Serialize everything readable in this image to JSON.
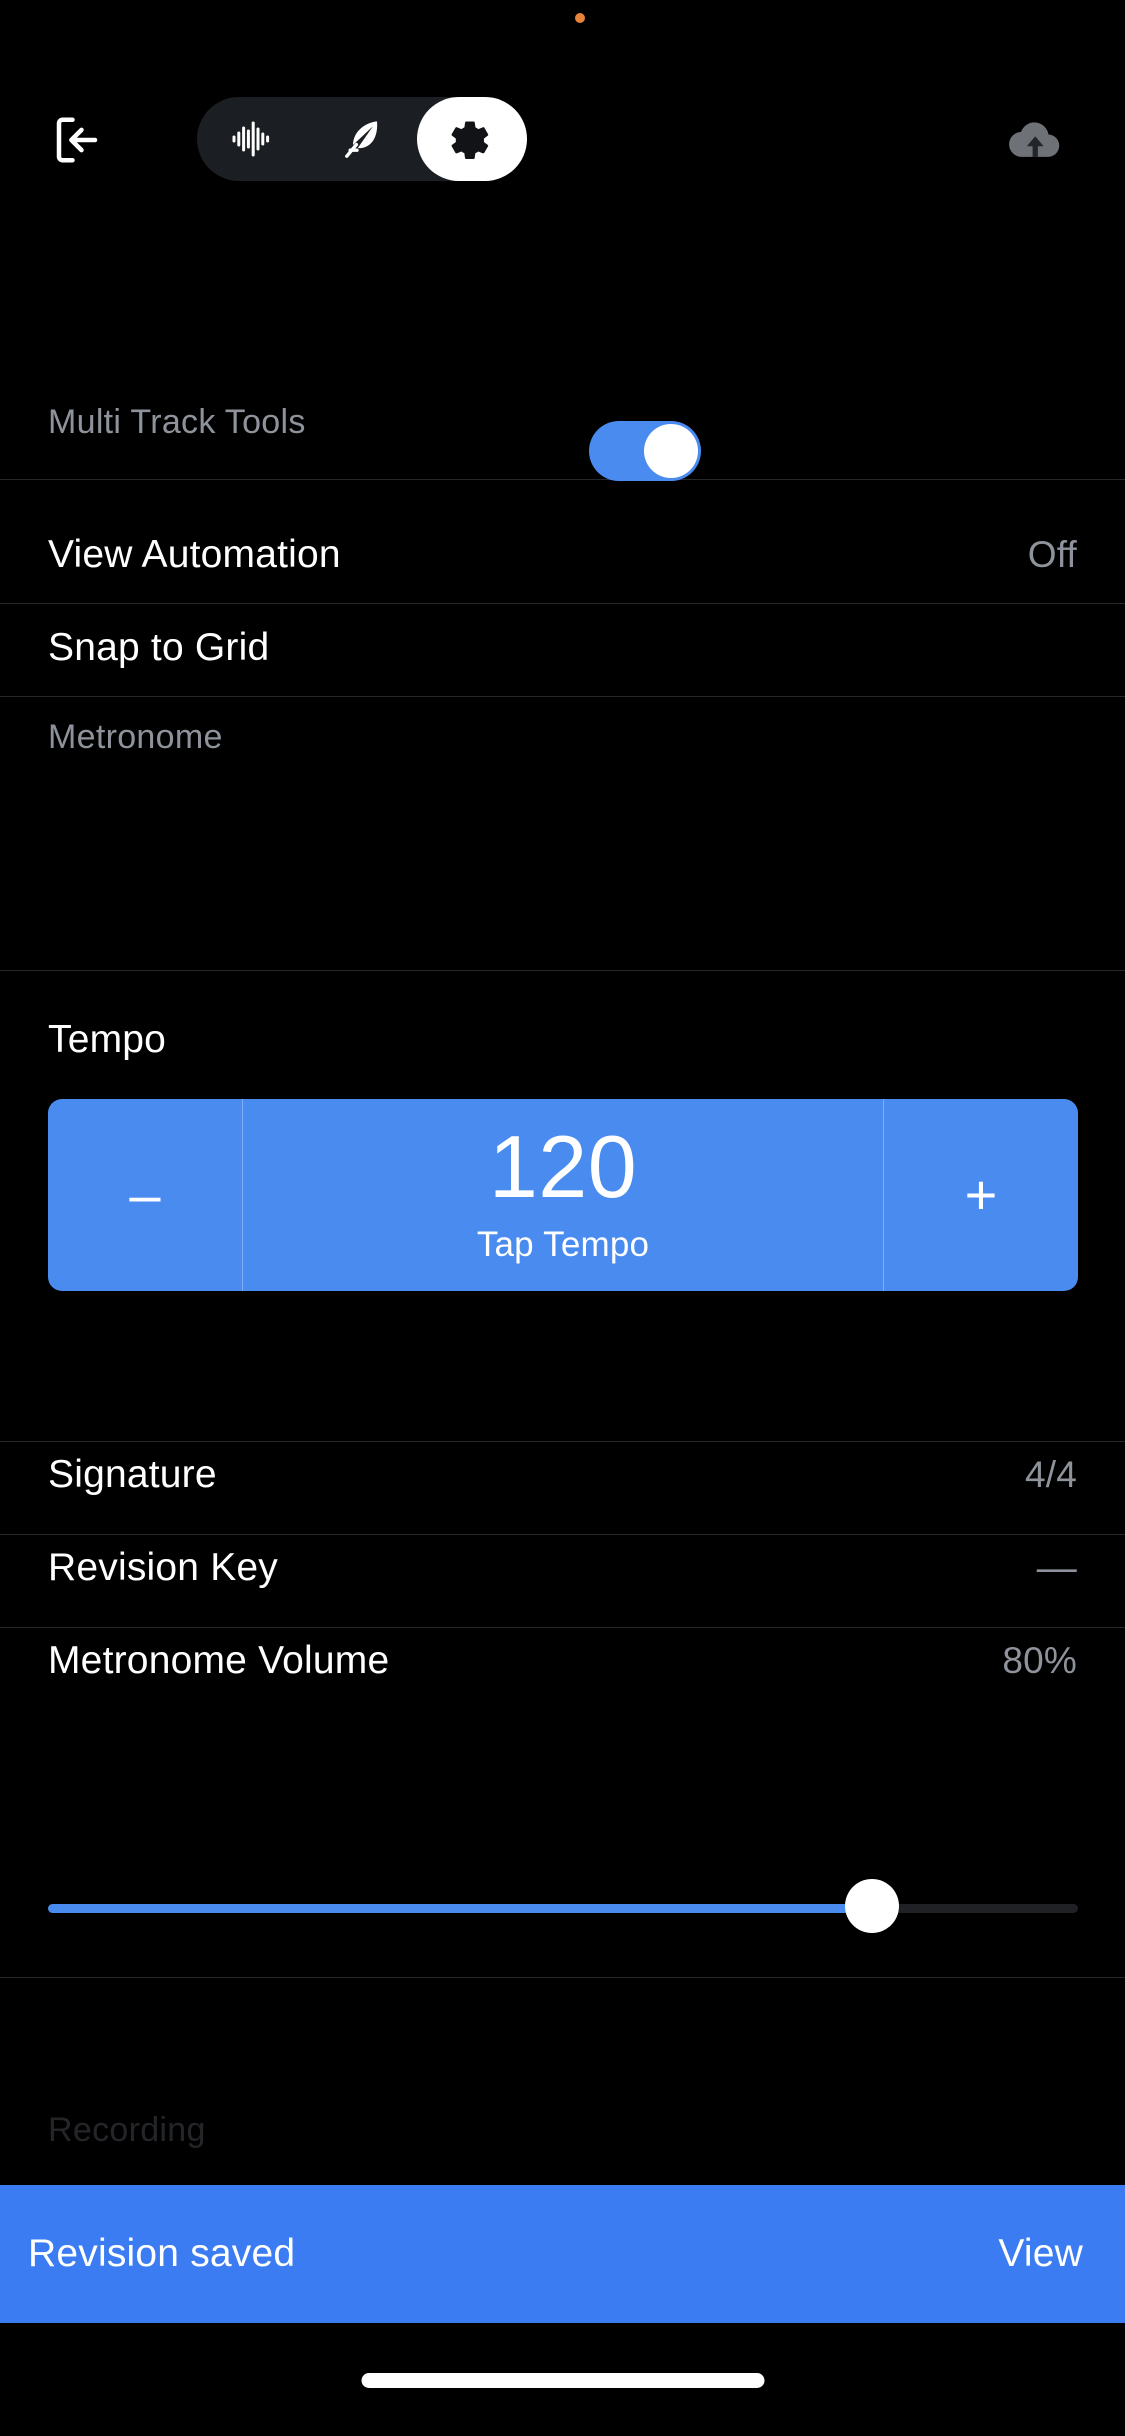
{
  "app": {
    "background_color": "#000000",
    "accent_color": "#4a8bf0",
    "muted_text_color": "#8e939b"
  },
  "status": {
    "recording_dot": "orange-dot",
    "recording_dot_color": "#e8833a"
  },
  "toolbar": {
    "exit_label": "Exit",
    "exit_icon": "exit-door-arrow-icon",
    "upload_label": "Upload",
    "upload_icon": "cloud-upload-icon",
    "upload_enabled": false,
    "segments": [
      {
        "id": "waveform",
        "icon": "audio-waveform-icon",
        "label": "Waveform",
        "active": false
      },
      {
        "id": "lyrics",
        "icon": "feather-quill-icon",
        "label": "Lyrics",
        "active": false
      },
      {
        "id": "settings",
        "icon": "gear-icon",
        "label": "Settings",
        "active": true
      }
    ]
  },
  "sections": [
    {
      "id": "multi-track-tools",
      "title": "Multi Track Tools",
      "dimmed": false
    },
    {
      "id": "metronome",
      "title": "Metronome",
      "dimmed": false
    },
    {
      "id": "recording",
      "title": "Recording",
      "dimmed": true
    }
  ],
  "rows": {
    "view_automation": {
      "label": "View Automation",
      "value": "Off"
    },
    "snap_to_grid": {
      "label": "Snap to Grid",
      "toggle_on": true
    },
    "tempo": {
      "label": "Tempo"
    },
    "signature": {
      "label": "Signature",
      "value": "4/4"
    },
    "revision_key": {
      "label": "Revision Key",
      "value": "—"
    },
    "metronome_volume": {
      "label": "Metronome Volume",
      "value": "80%",
      "percent": 80
    }
  },
  "tempo_stepper": {
    "decrement_label": "–",
    "value": "120",
    "tap_label": "Tap Tempo",
    "increment_label": "+"
  },
  "snackbar": {
    "message": "Revision saved",
    "action_label": "View"
  }
}
